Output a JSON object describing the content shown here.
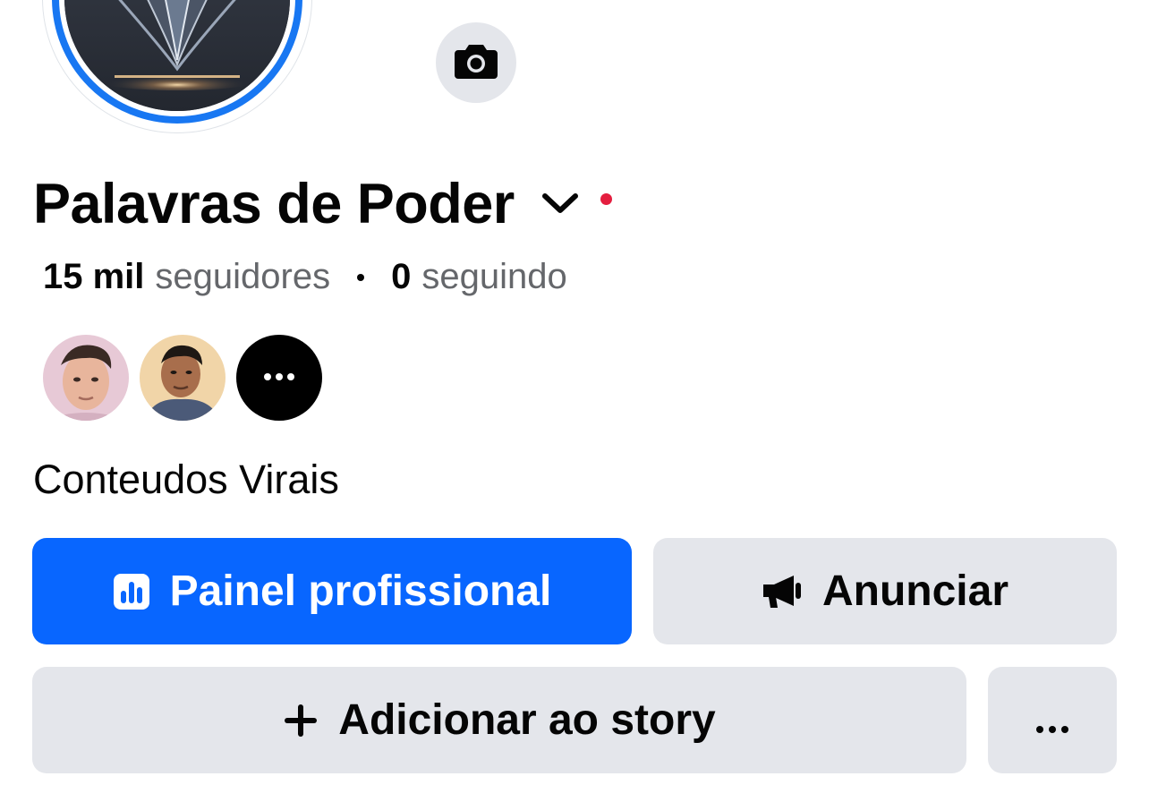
{
  "profile": {
    "name": "Palavras de Poder",
    "followers_count": "15 mil",
    "followers_label": "seguidores",
    "following_count": "0",
    "following_label": "seguindo",
    "bio": "Conteudos Virais",
    "ring_color": "#1877f2",
    "status_dot_color": "#e41e3f"
  },
  "icons": {
    "camera": "camera-icon",
    "chevron": "chevron-down-icon",
    "dashboard": "chart-icon",
    "megaphone": "megaphone-icon",
    "plus": "plus-icon",
    "more": "more-icon"
  },
  "friends": {
    "more_label": "•••"
  },
  "actions": {
    "professional_dashboard": "Painel profissional",
    "advertise": "Anunciar",
    "add_story": "Adicionar ao story",
    "more": "•••"
  },
  "colors": {
    "primary": "#0866ff",
    "secondary_bg": "#e4e6eb",
    "muted_text": "#65676b"
  }
}
